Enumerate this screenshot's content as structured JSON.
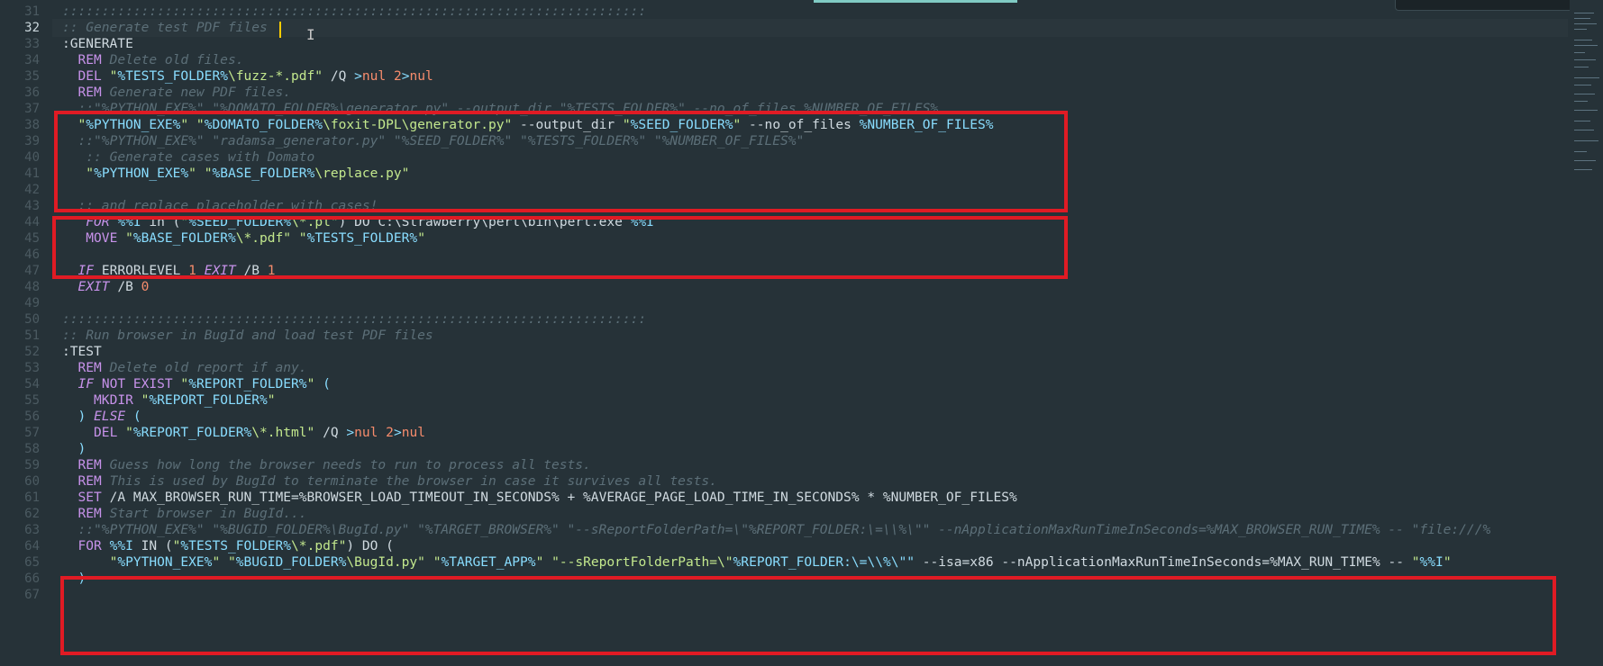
{
  "editor": {
    "theme": "material-dark",
    "colors": {
      "background": "#263238",
      "keyword": "#c792ea",
      "comment": "#5c6f78",
      "string": "#c3e88d",
      "variable": "#89ddff",
      "number": "#f78c6c",
      "highlight_box": "#e01b24"
    },
    "active_line": 32,
    "line_numbers": [
      "31",
      "32",
      "33",
      "34",
      "35",
      "36",
      "37",
      "38",
      "39",
      "40",
      "41",
      "42",
      "43",
      "44",
      "45",
      "46",
      "47",
      "48",
      "49",
      "50",
      "51",
      "52",
      "53",
      "54",
      "55",
      "56",
      "57",
      "58",
      "59",
      "60",
      "61",
      "62",
      "63",
      "64",
      "65",
      "66",
      "67"
    ],
    "lines": {
      "l31_sep": "::::::::::::::::::::::::::::::::::::::::::::::::::::::::::::::::::::::::::",
      "l32_comment": ":: Generate test PDF files",
      "l33_label": ":GENERATE",
      "l34_rem": "REM",
      "l34_text": " Delete old files.",
      "l35_del": "DEL",
      "l35_str_a": " \"",
      "l35_var": "%TESTS_FOLDER%",
      "l35_str_b": "\\fuzz-*.pdf\"",
      "l35_rest_a": " /Q ",
      "l35_gt": ">",
      "l35_nul": "nul",
      "l35_sp": " ",
      "l35_two": "2",
      "l35_gt2": ">",
      "l35_nul2": "nul",
      "l36_rem": "REM",
      "l36_text": " Generate new PDF files.",
      "l37_comment": "::\"%PYTHON_EXE%\" \"%DOMATO_FOLDER%\\generator.py\" --output_dir \"%TESTS_FOLDER%\" --no_of_files %NUMBER_OF_FILES%",
      "l38_q1": "\"",
      "l38_v1": "%PYTHON_EXE%",
      "l38_q2": "\" \"",
      "l38_v2": "%DOMATO_FOLDER%",
      "l38_s1": "\\foxit-DPL\\generator.py\"",
      "l38_t1": " --output_dir ",
      "l38_q3": "\"",
      "l38_v3": "%SEED_FOLDER%",
      "l38_q4": "\"",
      "l38_t2": " --no_of_files ",
      "l38_v4": "%NUMBER_OF_FILES%",
      "l39_comment": "::\"%PYTHON_EXE%\" \"radamsa_generator.py\" \"%SEED_FOLDER%\" \"%TESTS_FOLDER%\" \"%NUMBER_OF_FILES%\"",
      "l40_comment": " :: Generate cases with Domato",
      "l41_q1": " \"",
      "l41_v1": "%PYTHON_EXE%",
      "l41_q2": "\" \"",
      "l41_v2": "%BASE_FOLDER%",
      "l41_s1": "\\replace.py\"",
      "l43_comment": ":: and replace placeholder with cases!",
      "l44_for": " FOR",
      "l44_var": " %%I",
      "l44_in": " in (",
      "l44_q1": "\"",
      "l44_v1": "%SEED_FOLDER%",
      "l44_s1": "\\*.pl\"",
      "l44_rest": ") DO C:\\Strawberry\\perl\\bin\\perl.exe ",
      "l44_var2": "%%I",
      "l45_move": " MOVE",
      "l45_q1": " \"",
      "l45_v1": "%BASE_FOLDER%",
      "l45_s1": "\\*.pdf\"",
      "l45_q2": " \"",
      "l45_v2": "%TESTS_FOLDER%",
      "l45_q3": "\"",
      "l47_if": "IF",
      "l47_err": " ERRORLEVEL ",
      "l47_n1": "1",
      "l47_exit": " EXIT",
      "l47_b": " /B ",
      "l47_n2": "1",
      "l48_exit": "EXIT",
      "l48_b": " /B ",
      "l48_n": "0",
      "l50_sep": "::::::::::::::::::::::::::::::::::::::::::::::::::::::::::::::::::::::::::",
      "l51_comment": ":: Run browser in BugId and load test PDF files",
      "l52_label": ":TEST",
      "l53_rem": "REM",
      "l53_text": " Delete old report if any.",
      "l54_if": "IF",
      "l54_not": " NOT EXIST",
      "l54_q1": " \"",
      "l54_v1": "%REPORT_FOLDER%",
      "l54_q2": "\"",
      "l54_paren": " (",
      "l55_mkdir": "  MKDIR",
      "l55_q1": " \"",
      "l55_v1": "%REPORT_FOLDER%",
      "l55_q2": "\"",
      "l56_paren": ") ",
      "l56_else": "ELSE",
      "l56_paren2": " (",
      "l57_del": "  DEL",
      "l57_q1": " \"",
      "l57_v1": "%REPORT_FOLDER%",
      "l57_s1": "\\*.html\"",
      "l57_rest": " /Q ",
      "l57_gt": ">",
      "l57_nul": "nul",
      "l57_sp": " ",
      "l57_two": "2",
      "l57_gt2": ">",
      "l57_nul2": "nul",
      "l58_paren": ")",
      "l59_rem": "REM",
      "l59_text": " Guess how long the browser needs to run to process all tests.",
      "l60_rem": "REM",
      "l60_text": " This is used by BugId to terminate the browser in case it survives all tests.",
      "l61_set": "SET",
      "l61_rest": " /A MAX_BROWSER_RUN_TIME=%BROWSER_LOAD_TIMEOUT_IN_SECONDS% + %AVERAGE_PAGE_LOAD_TIME_IN_SECONDS% * %NUMBER_OF_FILES%",
      "l62_rem": "REM",
      "l62_text": " Start browser in BugId...",
      "l63_comment": "::\"%PYTHON_EXE%\" \"%BUGID_FOLDER%\\BugId.py\" \"%TARGET_BROWSER%\" \"--sReportFolderPath=\\\"%REPORT_FOLDER:\\=\\\\%\\\"\" --nApplicationMaxRunTimeInSeconds=%MAX_BROWSER_RUN_TIME% -- \"file:///%",
      "l64_for": "FOR",
      "l64_var": " %%I",
      "l64_in": " IN (",
      "l64_q1": "\"",
      "l64_v1": "%TESTS_FOLDER%",
      "l64_s1": "\\*.pdf\"",
      "l64_rest": ") DO (",
      "l65_q1": "    \"",
      "l65_v1": "%PYTHON_EXE%",
      "l65_q2": "\" \"",
      "l65_v2": "%BUGID_FOLDER%",
      "l65_s1": "\\BugId.py\"",
      "l65_q3": " \"",
      "l65_v3": "%TARGET_APP%",
      "l65_q4": "\"",
      "l65_s2": " \"--sReportFolderPath=\\\"",
      "l65_v4": "%REPORT_FOLDER:",
      "l65_esc": "\\=\\\\%\\\"\"",
      "l65_rest": " --isa=x86 --nApplicationMaxRunTimeInSeconds=%MAX_RUN_TIME% -- ",
      "l65_s3": "\"",
      "l65_v5": "%%I",
      "l65_s4": "\"",
      "l66_paren": ")"
    }
  }
}
